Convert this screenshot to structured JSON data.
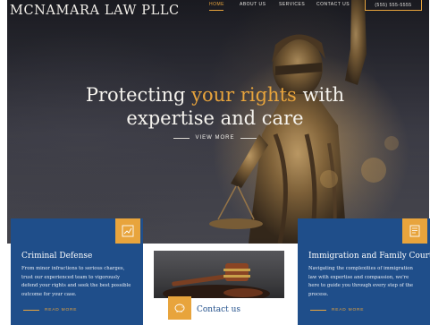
{
  "header": {
    "logo": "MCNAMARA LAW PLLC",
    "nav": [
      "HOME",
      "ABOUT US",
      "SERVICES",
      "CONTACT US"
    ],
    "cta": "(555) 555-5555"
  },
  "hero": {
    "headline_pre": "Protecting ",
    "headline_accent": "your rights",
    "headline_post": " with",
    "headline_line2": "expertise and care",
    "view_more": "VIEW MORE"
  },
  "cards": {
    "criminal": {
      "title": "Criminal Defense",
      "text": "From minor infractions to serious charges, trust our experienced team to vigorously defend your rights and seek the best possible outcome for your case.",
      "read_more": "READ MORE",
      "icon": "chart-icon"
    },
    "contact": {
      "title": "Contact us",
      "icon": "piggy-bank-icon"
    },
    "immigration": {
      "title": "Immigration and Family Court",
      "text": "Navigating the complexities of immigration law with expertise and compassion, we're here to guide you through every step of the process.",
      "read_more": "READ MORE",
      "icon": "document-icon"
    }
  },
  "colors": {
    "accent": "#e8a43c",
    "navy": "#1f4e8a"
  }
}
